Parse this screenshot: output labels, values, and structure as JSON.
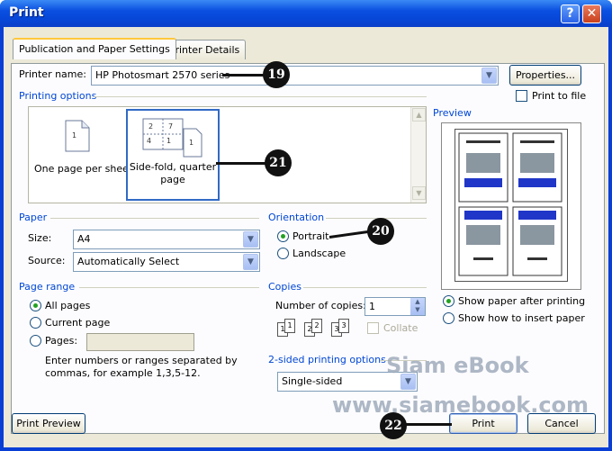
{
  "window": {
    "title": "Print",
    "help_label": "?",
    "close_label": "✕"
  },
  "tabs": [
    {
      "label": "Publication and Paper Settings",
      "active": true
    },
    {
      "label": "Printer Details",
      "active": false
    }
  ],
  "printer": {
    "name_label": "Printer name:",
    "name_value": "HP Photosmart 2570 series",
    "properties_label": "Properties...",
    "print_to_file_label": "Print to file",
    "print_to_file_checked": false
  },
  "printing_options": {
    "label": "Printing options",
    "items": [
      {
        "label": "One page per sheet",
        "selected": false
      },
      {
        "label": "Side-fold, quarter page",
        "selected": true
      }
    ]
  },
  "preview": {
    "label": "Preview",
    "show_paper_label": "Show paper after printing",
    "show_insert_label": "Show how to insert paper",
    "show_paper_selected": true
  },
  "paper": {
    "label": "Paper",
    "size_label": "Size:",
    "size_value": "A4",
    "source_label": "Source:",
    "source_value": "Automatically Select"
  },
  "orientation": {
    "label": "Orientation",
    "portrait_label": "Portrait",
    "landscape_label": "Landscape",
    "selected": "portrait"
  },
  "page_range": {
    "label": "Page range",
    "all_label": "All pages",
    "current_label": "Current page",
    "pages_label": "Pages:",
    "pages_value": "",
    "hint": "Enter numbers or ranges separated by commas, for example 1,3,5-12.",
    "selected": "all"
  },
  "copies": {
    "label": "Copies",
    "number_label": "Number of copies:",
    "number_value": "1",
    "collate_label": "Collate",
    "collate_checked": false,
    "icon_labels": [
      "1",
      "1",
      "2",
      "2",
      "3",
      "3"
    ]
  },
  "two_sided": {
    "label": "2-sided printing options",
    "value": "Single-sided"
  },
  "footer": {
    "print_preview_label": "Print Preview",
    "print_label": "Print",
    "cancel_label": "Cancel"
  },
  "callouts": [
    "19",
    "20",
    "21",
    "22"
  ],
  "watermark": {
    "line1": "Siam eBook",
    "line2": "www.siamebook.com"
  },
  "colors": {
    "titlebar": "#0a4fe0",
    "section_label": "#0046d5",
    "dialog_bg": "#ece9d8"
  }
}
